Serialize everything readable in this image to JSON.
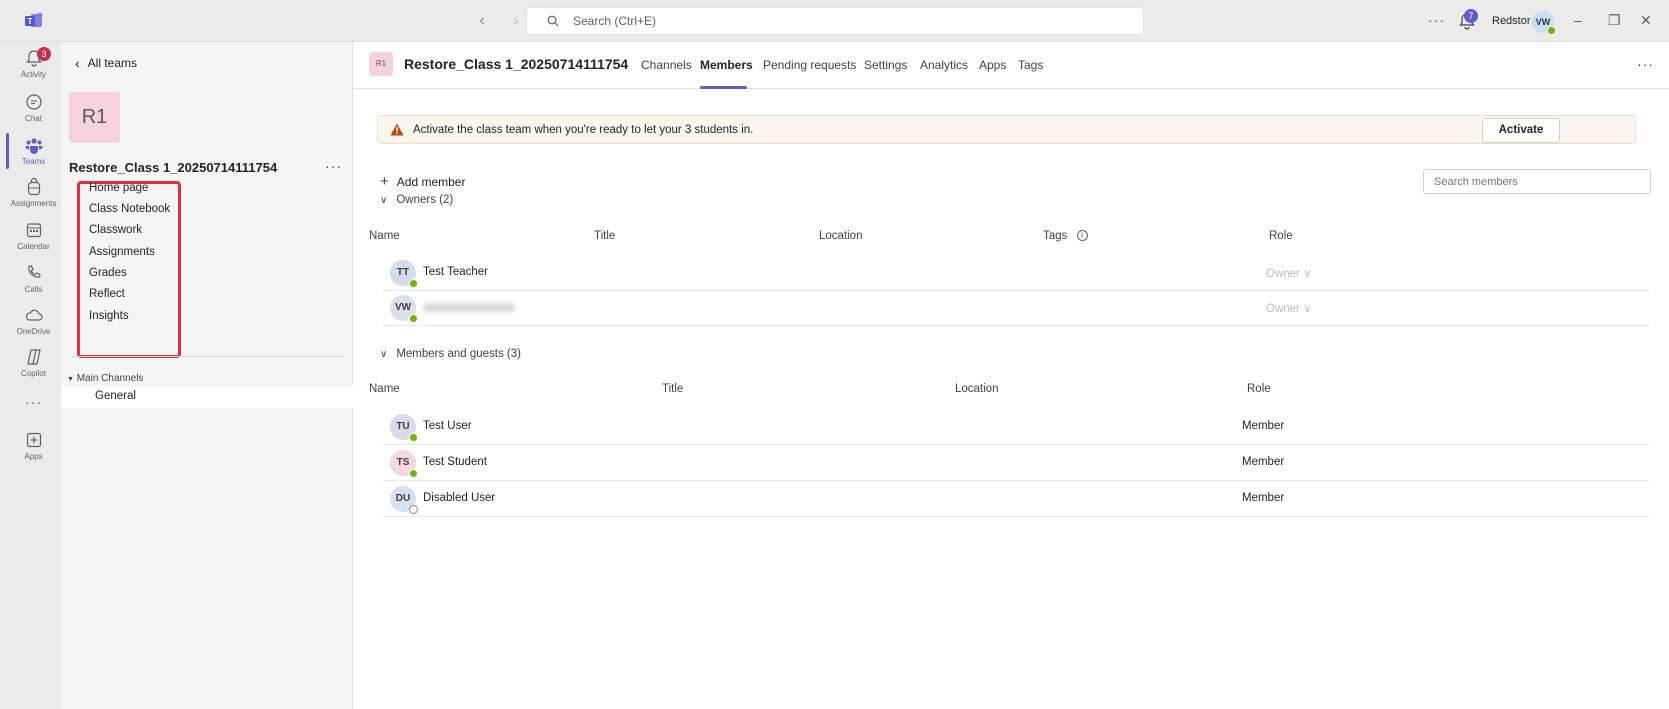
{
  "topbar": {
    "search_placeholder": "Search (Ctrl+E)",
    "notif_count": "7",
    "org_name": "Redstor",
    "user_initials": "VW"
  },
  "rail": {
    "activity_badge": "3",
    "items": [
      {
        "label": "Activity",
        "icon": "bell-icon"
      },
      {
        "label": "Chat",
        "icon": "chat-icon"
      },
      {
        "label": "Teams",
        "icon": "teams-icon"
      },
      {
        "label": "Assignments",
        "icon": "backpack-icon"
      },
      {
        "label": "Calendar",
        "icon": "calendar-icon"
      },
      {
        "label": "Calls",
        "icon": "phone-icon"
      },
      {
        "label": "OneDrive",
        "icon": "cloud-icon"
      },
      {
        "label": "Copilot",
        "icon": "copilot-icon"
      },
      {
        "label": "...",
        "icon": "more-icon"
      },
      {
        "label": "Apps",
        "icon": "apps-add-icon"
      }
    ]
  },
  "panel": {
    "back_label": "All teams",
    "team_initials": "R1",
    "team_name": "Restore_Class 1_20250714111754",
    "tabs": [
      "Home page",
      "Class Notebook",
      "Classwork",
      "Assignments",
      "Grades",
      "Reflect",
      "Insights"
    ],
    "channels_header": "Main Channels",
    "channel": "General"
  },
  "header": {
    "avatar": "R1",
    "title": "Restore_Class 1_20250714111754",
    "tabs": [
      "Channels",
      "Members",
      "Pending requests",
      "Settings",
      "Analytics",
      "Apps",
      "Tags"
    ],
    "active_tab": "Members"
  },
  "banner": {
    "text": "Activate the class team when you're ready to let your 3 students in.",
    "button": "Activate"
  },
  "members": {
    "add_label": "Add member",
    "search_placeholder": "Search members",
    "owners_header": "Owners (2)",
    "owners_columns": [
      "Name",
      "Title",
      "Location",
      "Tags",
      "Role"
    ],
    "owners": [
      {
        "initials": "TT",
        "name": "Test Teacher",
        "role": "Owner",
        "color": "#d3dcea"
      },
      {
        "initials": "VW",
        "name": "",
        "role": "Owner",
        "color": "#dbe1ea"
      }
    ],
    "guests_header": "Members and guests (3)",
    "guests_columns": [
      "Name",
      "Title",
      "Location",
      "Role"
    ],
    "guests": [
      {
        "initials": "TU",
        "name": "Test User",
        "role": "Member",
        "color": "#dcd9ea"
      },
      {
        "initials": "TS",
        "name": "Test Student",
        "role": "Member",
        "color": "#f3d6de"
      },
      {
        "initials": "DU",
        "name": "Disabled User",
        "role": "Member",
        "color": "#d6e0ee"
      }
    ]
  }
}
